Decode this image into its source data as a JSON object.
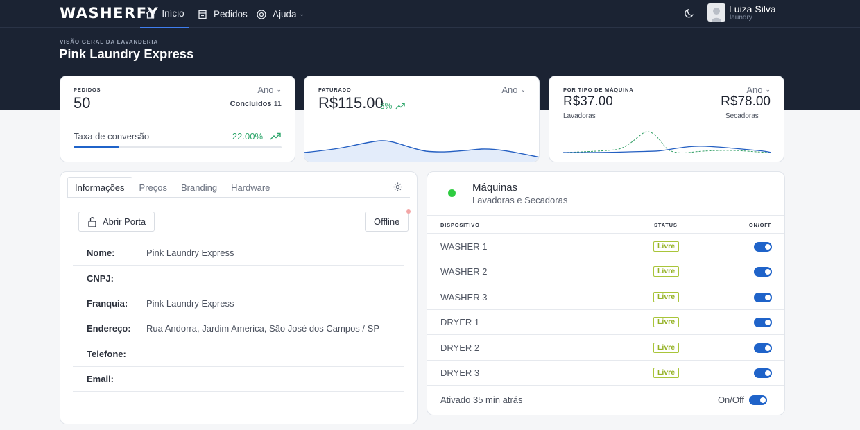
{
  "nav": {
    "logo": "WASHERFY",
    "items": [
      {
        "label": "Início",
        "icon": "home-icon"
      },
      {
        "label": "Pedidos",
        "icon": "orders-icon"
      },
      {
        "label": "Ajuda",
        "icon": "help-icon"
      }
    ],
    "user": {
      "name": "Luiza Silva",
      "role": "laundry"
    }
  },
  "header": {
    "overline": "VISÃO GERAL DA LAVANDERIA",
    "title": "Pink Laundry Express"
  },
  "orders_card": {
    "caption": "PEDIDOS",
    "total": "50",
    "period": "Ano",
    "completed_label": "Concluídos",
    "completed_value": "11",
    "conversion_label": "Taxa de conversão",
    "conversion_value": "22.00%",
    "conversion_fraction": 0.22
  },
  "revenue_card": {
    "caption": "FATURADO",
    "total": "R$115.00",
    "change": "8%",
    "period": "Ano"
  },
  "machine_type_card": {
    "caption": "POR TIPO DE MÁQUINA",
    "period": "Ano",
    "washers_value": "R$37.00",
    "washers_label": "Lavadoras",
    "dryers_value": "R$78.00",
    "dryers_label": "Secadoras"
  },
  "info_panel": {
    "tabs": [
      "Informações",
      "Preços",
      "Branding",
      "Hardware"
    ],
    "open_door_label": "Abrir Porta",
    "status_button": "Offline",
    "fields": [
      {
        "label": "Nome:",
        "value": "Pink Laundry Express"
      },
      {
        "label": "CNPJ:",
        "value": ""
      },
      {
        "label": "Franquia:",
        "value": "Pink Laundry Express"
      },
      {
        "label": "Endereço:",
        "value": "Rua Andorra, Jardim America, São José dos Campos / SP"
      },
      {
        "label": "Telefone:",
        "value": ""
      },
      {
        "label": "Email:",
        "value": ""
      }
    ]
  },
  "machines_panel": {
    "title": "Máquinas",
    "subtitle": "Lavadoras e Secadoras",
    "columns": {
      "device": "DISPOSITIVO",
      "status": "STATUS",
      "onoff": "ON/OFF"
    },
    "machines": [
      {
        "name": "WASHER 1",
        "status": "Livre",
        "on": true
      },
      {
        "name": "WASHER 2",
        "status": "Livre",
        "on": true
      },
      {
        "name": "WASHER 3",
        "status": "Livre",
        "on": true
      },
      {
        "name": "DRYER 1",
        "status": "Livre",
        "on": true
      },
      {
        "name": "DRYER 2",
        "status": "Livre",
        "on": true
      },
      {
        "name": "DRYER 3",
        "status": "Livre",
        "on": true
      }
    ],
    "footer_text": "Ativado 35 min atrás",
    "footer_toggle_label": "On/Off"
  },
  "colors": {
    "header_bg": "#1b2333",
    "accent_blue": "#1f63c9",
    "online_green": "#2ecc40",
    "badge_green": "#95b226",
    "trend_green": "#2ea66b"
  }
}
